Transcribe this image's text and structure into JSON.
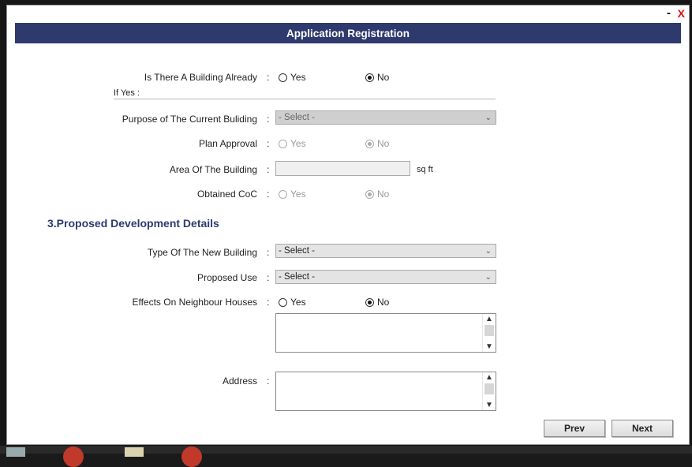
{
  "window": {
    "minimize_label": "-",
    "close_label": "X"
  },
  "header": {
    "title": "Application Registration"
  },
  "form": {
    "building_already": {
      "label": "Is There A Building Already",
      "colon": ":",
      "yes": "Yes",
      "no": "No",
      "selected": "No"
    },
    "if_yes_label": "If Yes :",
    "purpose": {
      "label": "Purpose of The Current Buliding",
      "colon": ":",
      "value": "- Select -"
    },
    "plan_approval": {
      "label": "Plan Approval",
      "colon": ":",
      "yes": "Yes",
      "no": "No",
      "selected": "No"
    },
    "area": {
      "label": "Area Of The Building",
      "colon": ":",
      "value": "",
      "unit": "sq ft"
    },
    "obtained_coc": {
      "label": "Obtained CoC",
      "colon": ":",
      "yes": "Yes",
      "no": "No",
      "selected": "No"
    },
    "section_title": "3.Proposed Development Details",
    "type_new_building": {
      "label": "Type Of The New Building",
      "colon": ":",
      "value": "- Select -"
    },
    "proposed_use": {
      "label": "Proposed Use",
      "colon": ":",
      "value": "- Select -"
    },
    "effects_neighbour": {
      "label": "Effects On Neighbour Houses",
      "colon": ":",
      "yes": "Yes",
      "no": "No",
      "selected": "No",
      "value": ""
    },
    "address": {
      "label": "Address",
      "colon": ":",
      "value": ""
    }
  },
  "buttons": {
    "prev": "Prev",
    "next": "Next"
  },
  "colors": {
    "header_bg": "#2e3a6e",
    "section_title": "#2e3a6e",
    "close_x": "#dd1111"
  },
  "icons": {
    "dropdown": "chevron-down-icon",
    "scroll_up": "scroll-up-icon",
    "scroll_down": "scroll-down-icon"
  }
}
